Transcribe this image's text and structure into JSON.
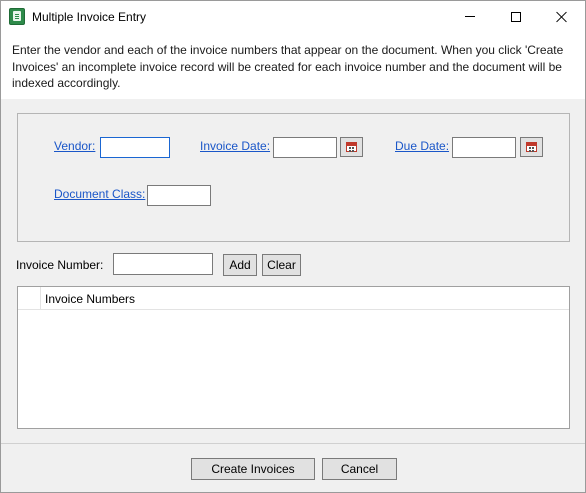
{
  "window": {
    "title": "Multiple Invoice Entry",
    "controls": {
      "minimize": "minimize-icon",
      "maximize": "maximize-icon",
      "close": "close-icon"
    }
  },
  "description": "Enter the vendor and each of the invoice numbers that appear on the document. When you click 'Create Invoices' an incomplete invoice record will be created for each invoice number and the document will be indexed accordingly.",
  "form": {
    "vendor": {
      "label": "Vendor:",
      "value": ""
    },
    "invoice_date": {
      "label": "Invoice Date:",
      "value": ""
    },
    "due_date": {
      "label": "Due Date:",
      "value": ""
    },
    "document_class": {
      "label": "Document Class:",
      "value": ""
    }
  },
  "invoice_entry": {
    "label": "Invoice Number:",
    "value": "",
    "add_label": "Add",
    "clear_label": "Clear"
  },
  "grid": {
    "columns": [
      "Invoice Numbers"
    ],
    "rows": []
  },
  "footer": {
    "create_label": "Create Invoices",
    "cancel_label": "Cancel"
  },
  "colors": {
    "link": "#1a56c8",
    "focus_border": "#1a66d2",
    "app_icon": "#2e8b4a"
  }
}
